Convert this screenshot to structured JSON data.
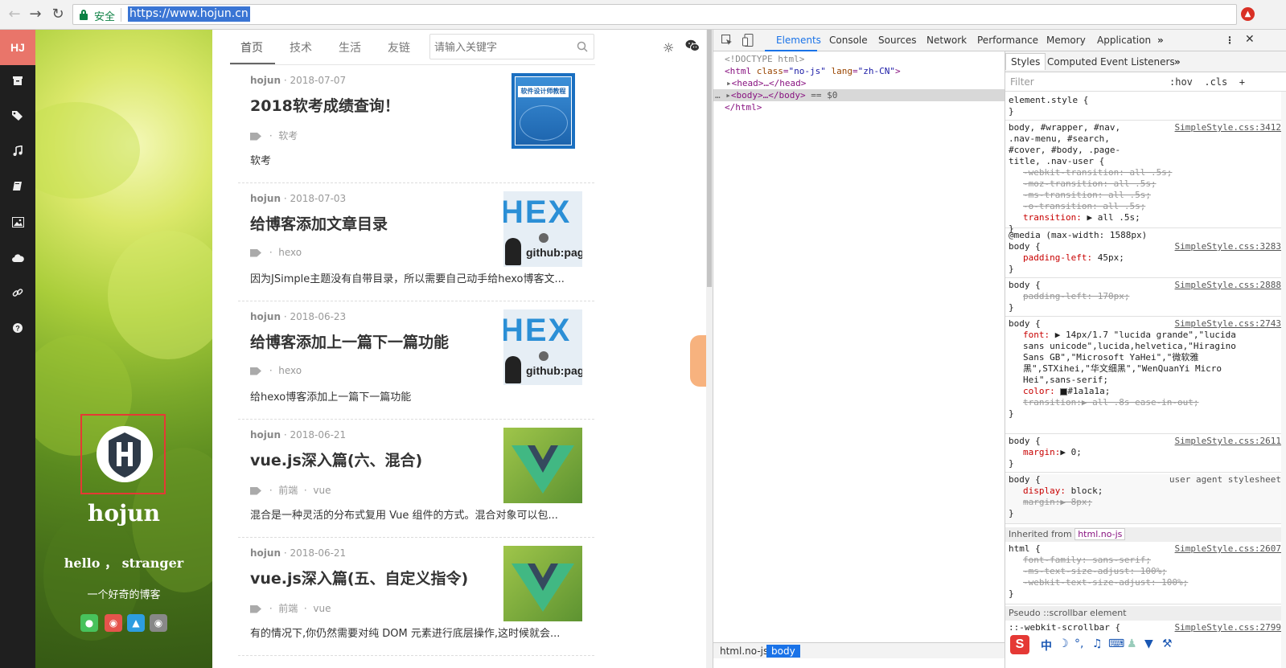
{
  "browser": {
    "secure_label": "安全",
    "url": "https://www.hojun.cn"
  },
  "sidebar": {
    "logo": "HJ",
    "icons": [
      "archive-icon",
      "tags-icon",
      "music-icon",
      "book-icon",
      "image-icon",
      "cloud-icon",
      "link-icon",
      "help-icon"
    ]
  },
  "cover": {
    "name": "hojun",
    "greeting": "hello ， stranger",
    "tagline": "一个好奇的博客",
    "social": [
      "wechat-icon",
      "weibo-icon",
      "qq-icon",
      "github-icon"
    ]
  },
  "nav": {
    "tabs": [
      "首页",
      "技术",
      "生活",
      "友链"
    ],
    "search_placeholder": "请输入关键字"
  },
  "articles": [
    {
      "author": "hojun",
      "date": "2018-07-07",
      "title": "2018软考成绩查询！",
      "tags": [
        "软考"
      ],
      "excerpt": "软考",
      "thumb_text": "软件设计师教程"
    },
    {
      "author": "hojun",
      "date": "2018-07-03",
      "title": "给博客添加文章目录",
      "tags": [
        "hexo"
      ],
      "excerpt": "因为JSimple主题没有自带目录，所以需要自己动手给hexo博客文...",
      "thumb_text": "HEX"
    },
    {
      "author": "hojun",
      "date": "2018-06-23",
      "title": "给博客添加上一篇下一篇功能",
      "tags": [
        "hexo"
      ],
      "excerpt": "给hexo博客添加上一篇下一篇功能",
      "thumb_text": "HEX"
    },
    {
      "author": "hojun",
      "date": "2018-06-21",
      "title": "vue.js深入篇(六、混合)",
      "tags": [
        "前端",
        "vue"
      ],
      "excerpt": "混合是一种灵活的分布式复用 Vue 组件的方式。混合对象可以包...",
      "thumb_text": "V"
    },
    {
      "author": "hojun",
      "date": "2018-06-21",
      "title": "vue.js深入篇(五、自定义指令)",
      "tags": [
        "前端",
        "vue"
      ],
      "excerpt": "有的情况下,你仍然需要对纯 DOM 元素进行底层操作,这时候就会...",
      "thumb_text": "V"
    }
  ],
  "devtools": {
    "tabs": [
      "Elements",
      "Console",
      "Sources",
      "Network",
      "Performance",
      "Memory",
      "Application"
    ],
    "dom": {
      "doctype": "<!DOCTYPE html>",
      "html_open_tag": "<html",
      "class_attr": "class",
      "class_val": "\"no-js\"",
      "lang_attr": "lang",
      "lang_val": "\"zh-CN\"",
      "head": "<head>…</head>",
      "body": "<body>…</body>",
      "body_suffix": "== $0",
      "html_close": "</html>"
    },
    "breadcrumb": [
      "html.no-js",
      "body"
    ],
    "styles_tabs": [
      "Styles",
      "Computed",
      "Event Listeners"
    ],
    "filter_placeholder": "Filter",
    "hov": ":hov",
    "cls": ".cls",
    "rules": {
      "r1_sel": "element.style {",
      "r2_sel": "body, #wrapper, #nav, .nav-menu, #search, #cover, #body, .page-title, .nav-user {",
      "r2_src": "SimpleStyle.css:3412",
      "r2_p1": "-webkit-transition: all .5s;",
      "r2_p2": "-moz-transition: all .5s;",
      "r2_p3": "-ms-transition: all .5s;",
      "r2_p4": "-o-transition: all .5s;",
      "r2_p5n": "transition:",
      "r2_p5v": "▶ all .5s;",
      "media": "@media (max-width: 1588px)",
      "r3_sel": "body {",
      "r3_src": "SimpleStyle.css:3283",
      "r3_pn": "padding-left:",
      "r3_pv": "45px;",
      "r4_src": "SimpleStyle.css:2888",
      "r4_p": "padding-left: 170px;",
      "r5_src": "SimpleStyle.css:2743",
      "r5_fn": "font:",
      "r5_fv": "▶ 14px/1.7 \"lucida grande\",\"lucida sans unicode\",lucida,helvetica,\"Hiragino Sans GB\",\"Microsoft YaHei\",\"微软雅黑\",STXihei,\"华文细黑\",\"WenQuanYi Micro Hei\",sans-serif;",
      "r5_cn": "color:",
      "r5_cv": "#1a1a1a;",
      "r5_t": "transition:▶ all .8s ease-in-out;",
      "r6_src": "SimpleStyle.css:2611",
      "r6_pn": "margin:",
      "r6_pv": "▶ 0;",
      "r7_src": "user agent stylesheet",
      "r7_dn": "display:",
      "r7_dv": "block;",
      "r7_m": "margin:▶ 8px;",
      "inherited_label": "Inherited from",
      "inherited_from": "html.no-js",
      "r8_sel": "html {",
      "r8_src": "SimpleStyle.css:2607",
      "r8_p1": "font-family: sans-serif;",
      "r8_p2": "-ms-text-size-adjust: 100%;",
      "r8_p3": "-webkit-text-size-adjust: 100%;",
      "pseudo": "Pseudo ::scrollbar element",
      "r9_sel": "::-webkit-scrollbar {",
      "r9_src": "SimpleStyle.css:2799",
      "close": "}"
    }
  },
  "ime": {
    "mode": "中"
  }
}
